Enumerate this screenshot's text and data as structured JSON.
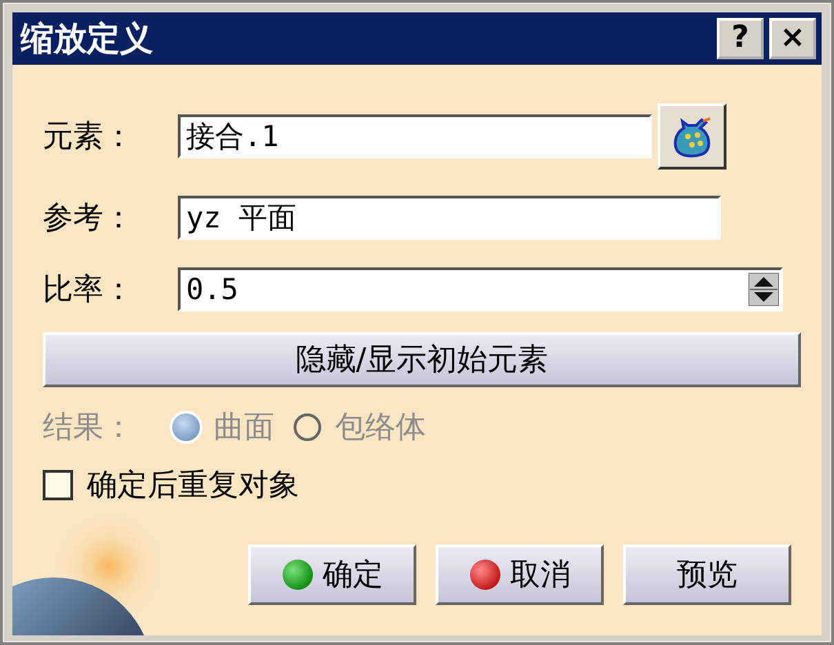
{
  "window": {
    "title": "缩放定义",
    "help_button": "?",
    "close_button": "×"
  },
  "fields": [
    {
      "label": "元素：",
      "value": "接合.1",
      "kind": "select"
    },
    {
      "label": "参考：",
      "value": "yz 平面",
      "kind": "text"
    },
    {
      "label": "比率：",
      "value": "0.5",
      "kind": "spinner"
    }
  ],
  "toggle_button": "隐藏/显示初始元素",
  "result": {
    "label": "结果：",
    "disabled": true,
    "options": [
      {
        "label": "曲面",
        "selected": true
      },
      {
        "label": "包络体",
        "selected": false
      }
    ]
  },
  "repeat_checkbox": {
    "label": "确定后重复对象",
    "checked": false
  },
  "buttons": [
    {
      "label": "确定",
      "kind": "ok"
    },
    {
      "label": "取消",
      "kind": "cancel"
    },
    {
      "label": "预览",
      "kind": "plain"
    }
  ]
}
